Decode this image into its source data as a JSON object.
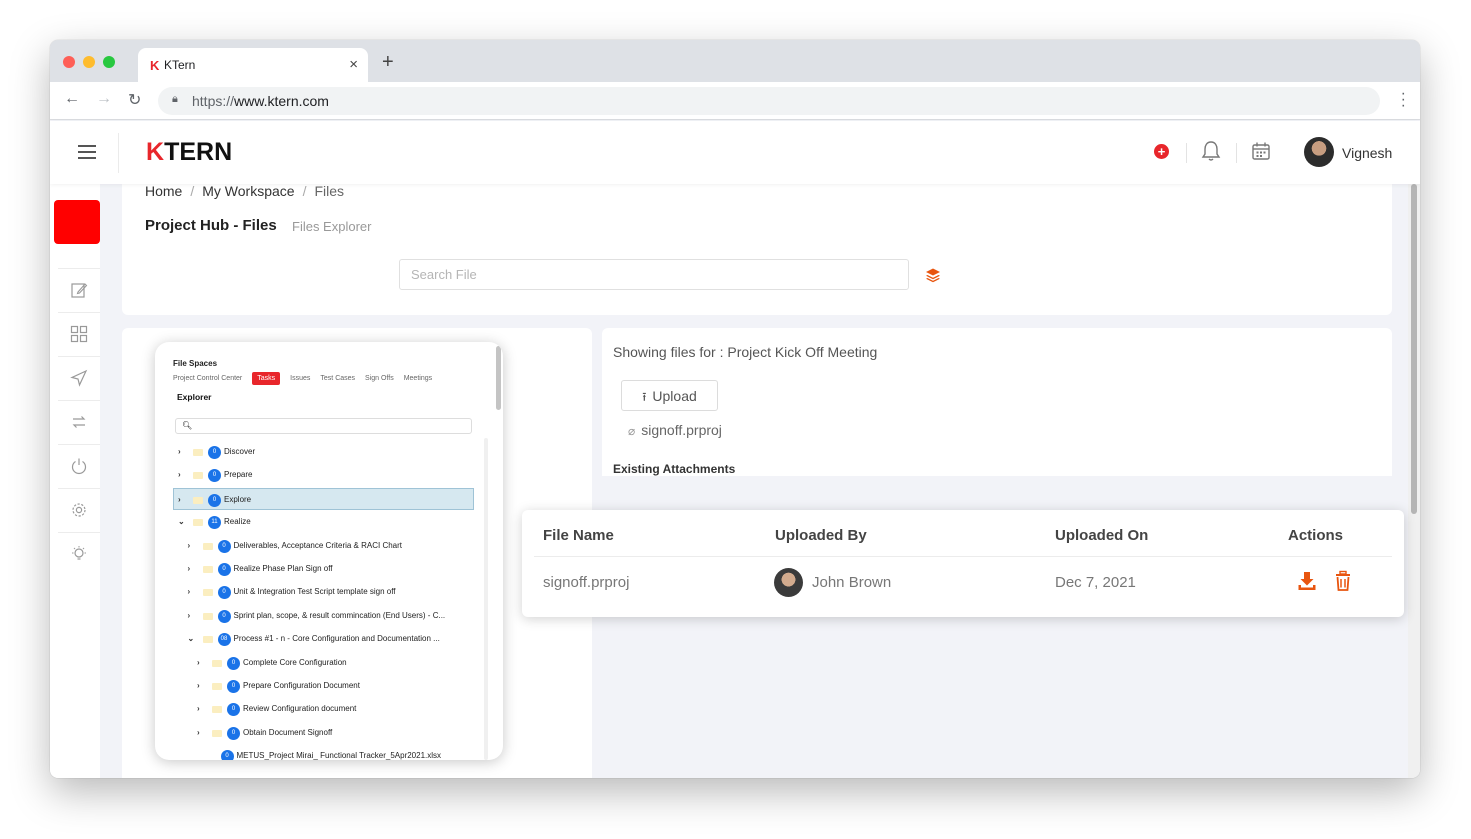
{
  "browser": {
    "tab_title": "KTern",
    "tab_favicon": "K",
    "close_glyph": "×",
    "newtab_glyph": "+",
    "url_scheme": "https://",
    "url_host": "www.ktern.com"
  },
  "header": {
    "logo_k": "K",
    "logo_rest": "TERN",
    "user_name": "Vignesh",
    "icons": [
      "hamburger-icon",
      "plus-icon",
      "bell-icon",
      "calendar-icon"
    ]
  },
  "breadcrumb": [
    "Home",
    "My Workspace",
    "Files"
  ],
  "page": {
    "title": "Project Hub - Files",
    "subtitle": "Files Explorer",
    "search_placeholder": "Search File"
  },
  "explorer": {
    "title": "File Spaces",
    "tabs": [
      "Project Control Center",
      "Tasks",
      "Issues",
      "Test Cases",
      "Sign Offs",
      "Meetings"
    ],
    "active_tab": "Tasks",
    "subtitle": "Explorer",
    "tree": [
      {
        "label": "Discover",
        "count": "0",
        "expanded": false
      },
      {
        "label": "Prepare",
        "count": "0",
        "expanded": false
      },
      {
        "label": "Explore",
        "count": "0",
        "expanded": false,
        "selected": true
      },
      {
        "label": "Realize",
        "count": "11",
        "expanded": true
      },
      {
        "label": "Deliverables, Acceptance Criteria & RACI Chart",
        "count": "0",
        "expanded": false
      },
      {
        "label": "Realize Phase Plan Sign off",
        "count": "0",
        "expanded": false
      },
      {
        "label": "Unit & Integration Test Script template sign off",
        "count": "0",
        "expanded": false
      },
      {
        "label": "Sprint plan, scope, & result commincation (End Users) - C...",
        "count": "0",
        "expanded": false
      },
      {
        "label": "Process #1 - n - Core Configuration and Documentation ...",
        "count": "08",
        "expanded": true
      },
      {
        "label": "Complete Core Configuration",
        "count": "0",
        "expanded": false
      },
      {
        "label": "Prepare Configuration Document",
        "count": "0",
        "expanded": false
      },
      {
        "label": "Review Configuration document",
        "count": "0",
        "expanded": false
      },
      {
        "label": "Obtain Document Signoff",
        "count": "0",
        "expanded": false
      },
      {
        "label": "METUS_Project Mirai_ Functional Tracker_5Apr2021.xlsx",
        "count": "0",
        "expanded": false
      }
    ]
  },
  "files_panel": {
    "showing_label": "Showing files for : Project Kick Off Meeting",
    "upload_label": "Upload",
    "pending_file": "signoff.prproj",
    "existing_label": "Existing Attachments"
  },
  "attachments_table": {
    "columns": [
      "File Name",
      "Uploaded By",
      "Uploaded On",
      "Actions"
    ],
    "rows": [
      {
        "file_name": "signoff.prproj",
        "uploaded_by": "John Brown",
        "uploaded_on": "Dec 7, 2021"
      }
    ]
  },
  "colors": {
    "brand_red": "#e8262b",
    "action_orange": "#e8550f",
    "badge_blue": "#1a73e8"
  }
}
